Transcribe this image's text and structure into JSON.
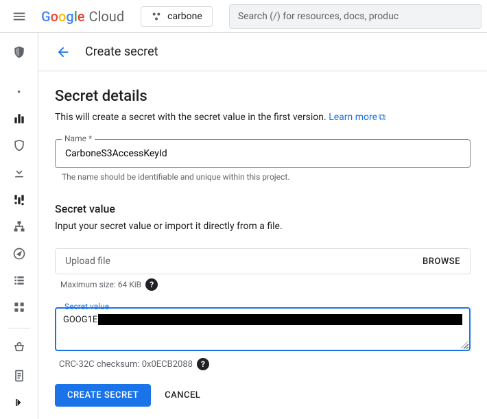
{
  "topbar": {
    "logo_cloud": "Cloud",
    "project_name": "carbone",
    "search_placeholder": "Search (/) for resources, docs, produc"
  },
  "page": {
    "title": "Create secret"
  },
  "details": {
    "heading": "Secret details",
    "description": "This will create a secret with the secret value in the first version.",
    "learn_more": "Learn more",
    "name_label": "Name",
    "name_value": "CarboneS3AccessKeyId",
    "name_helper": "The name should be identifiable and unique within this project."
  },
  "secret_value": {
    "heading": "Secret value",
    "description": "Input your secret value or import it directly from a file.",
    "upload_placeholder": "Upload file",
    "browse_label": "BROWSE",
    "max_size_label": "Maximum size: 64 KiB",
    "value_label": "Secret value",
    "value_visible_prefix": "GOOG1E",
    "checksum_label": "CRC-32C checksum: 0x0ECB2088"
  },
  "footer": {
    "create_label": "CREATE SECRET",
    "cancel_label": "CANCEL"
  }
}
